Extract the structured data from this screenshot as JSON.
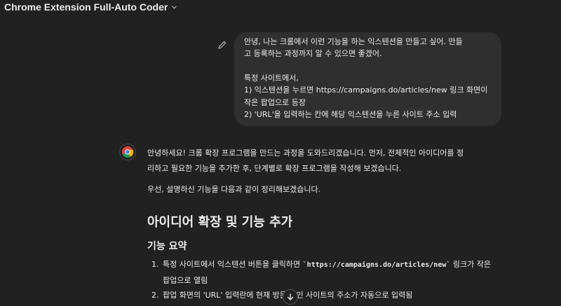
{
  "header": {
    "title": "Chrome Extension Full-Auto Coder"
  },
  "user_message": {
    "lines": [
      "안녕, 나는 크롬에서 이런 기능을 하는 익스텐션을 만들고 싶어. 만들",
      "고 등록하는 과정까지 알 수 있으면 좋겠어.",
      "",
      "특정 사이트에서,",
      "1) 익스텐션을 누르면 https://campaigns.do/articles/new 링크 화면이",
      "작은 팝업으로 등장",
      "2) 'URL'을 입력하는 칸에 해당 익스텐션을 누른 사이트 주소 입력"
    ]
  },
  "assistant": {
    "intro_1": "안녕하세요! 크롬 확장 프로그램을 만드는 과정을 도와드리겠습니다. 먼저, 전체적인 아이디어를 정",
    "intro_2": "리하고 필요한 기능을 추가한 후, 단계별로 확장 프로그램을 작성해 보겠습니다.",
    "intro_3": "우선, 설명하신 기능을 다음과 같이 정리해보겠습니다.",
    "heading": "아이디어 확장 및 기능 추가",
    "subheading": "기능 요약",
    "list": [
      {
        "num": "1.",
        "pre": "특정 사이트에서 익스텐션 버튼을 클릭하면 ",
        "code": "`https://campaigns.do/articles/new`",
        "post": " 링크가 작은",
        "line2": "팝업으로 열림"
      },
      {
        "num": "2.",
        "text": "팝업 화면의 'URL' 입력란에 현재 방문 중인 사이트의 주소가 자동으로 입력됨"
      }
    ]
  }
}
